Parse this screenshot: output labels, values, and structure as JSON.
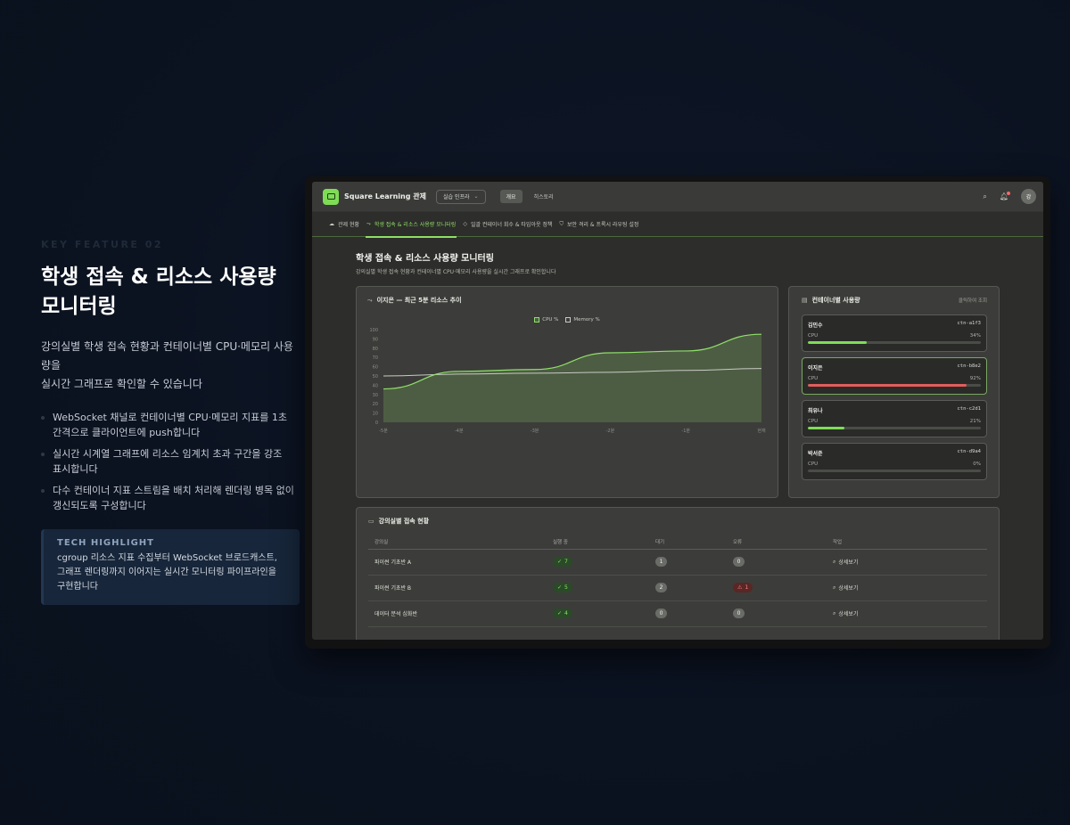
{
  "left": {
    "kicker": "KEY FEATURE 02",
    "title_line1": "학생 접속 & 리소스 사용량",
    "title_line2": "모니터링",
    "desc_line1": "강의실별 학생 접속 현황과 컨테이너별 CPU·메모리 사용량을",
    "desc_line2": "실시간 그래프로 확인할 수 있습니다",
    "bullets": [
      {
        "l1": "WebSocket 채널로 컨테이너별 CPU·메모리 지표를 1초",
        "l2": "간격으로 클라이언트에 push합니다"
      },
      {
        "l1": "실시간 시계열 그래프에 리소스 임계치 초과 구간을 강조",
        "l2": "표시합니다"
      },
      {
        "l1": "다수 컨테이너 지표 스트림을 배치 처리해 렌더링 병목 없이",
        "l2": "갱신되도록 구성합니다"
      }
    ],
    "tech": {
      "title": "TECH HIGHLIGHT",
      "l1": "cgroup 리소스 지표 수집부터 WebSocket 브로드캐스트,",
      "l2": "그래프 렌더링까지 이어지는 실시간 모니터링 파이프라인을",
      "l3": "구현합니다"
    }
  },
  "app": {
    "brand": "Square Learning 관제",
    "selector": "실습 인프라",
    "top_tabs": [
      "개요",
      "히스토리"
    ],
    "avatar": "강",
    "nav_tabs": [
      {
        "icon": "☁",
        "label": "관제 현황"
      },
      {
        "icon": "⤳",
        "label": "학생 접속 & 리소스 사용량 모니터링"
      },
      {
        "icon": "◇",
        "label": "일괄 컨테이너 회수 & 타임아웃 정책"
      },
      {
        "icon": "⛉",
        "label": "보안 격리 & 프록시 라우팅 설정"
      }
    ],
    "page_title": "학생 접속 & 리소스 사용량 모니터링",
    "page_sub": "강의실별 학생 접속 현황과 컨테이너별 CPU·메모리 사용량을 실시간 그래프로 확인합니다",
    "chart_title": "이지은 — 최근 5분 리소스 추이",
    "containers_title": "컨테이너별 사용량",
    "containers_hint": "클릭하여 조회",
    "containers": [
      {
        "name": "김민수",
        "id": "ctn-a1f3",
        "label": "CPU",
        "pct": "34%",
        "value": 34,
        "color": "#7fdc56",
        "alert": false
      },
      {
        "name": "이지은",
        "id": "ctn-b8e2",
        "label": "CPU",
        "pct": "92%",
        "value": 92,
        "color": "#e25d5d",
        "alert": true
      },
      {
        "name": "최유나",
        "id": "ctn-c2d1",
        "label": "CPU",
        "pct": "21%",
        "value": 21,
        "color": "#7fdc56",
        "alert": false
      },
      {
        "name": "박서준",
        "id": "ctn-d9a4",
        "label": "CPU",
        "pct": "0%",
        "value": 0,
        "color": "#7fdc56",
        "alert": false
      }
    ],
    "table_title": "강의실별 접속 현황",
    "table_headers": [
      "강의실",
      "실행 중",
      "대기",
      "오류",
      "작업"
    ],
    "rows": [
      {
        "room": "파이썬 기초반 A",
        "running": "7",
        "waiting": "1",
        "error": "0",
        "error_alert": false,
        "action": "상세보기"
      },
      {
        "room": "파이썬 기초반 B",
        "running": "5",
        "waiting": "2",
        "error": "1",
        "error_alert": true,
        "action": "상세보기"
      },
      {
        "room": "데이터 분석 심화반",
        "running": "4",
        "waiting": "0",
        "error": "0",
        "error_alert": false,
        "action": "상세보기"
      }
    ]
  },
  "chart_data": {
    "type": "line",
    "x": [
      "-5분",
      "-4분",
      "-3분",
      "-2분",
      "-1분",
      "현재"
    ],
    "ylim": [
      0,
      100
    ],
    "yticks": [
      0,
      10,
      20,
      30,
      40,
      50,
      60,
      70,
      80,
      90,
      100
    ],
    "series": [
      {
        "name": "CPU %",
        "color": "#8fe06a",
        "values": [
          36,
          55,
          57,
          75,
          77,
          95
        ]
      },
      {
        "name": "Memory %",
        "color": "#c8cac4",
        "values": [
          50,
          52,
          53,
          54,
          56,
          58
        ]
      }
    ],
    "legend": "top-center",
    "grid": false
  }
}
